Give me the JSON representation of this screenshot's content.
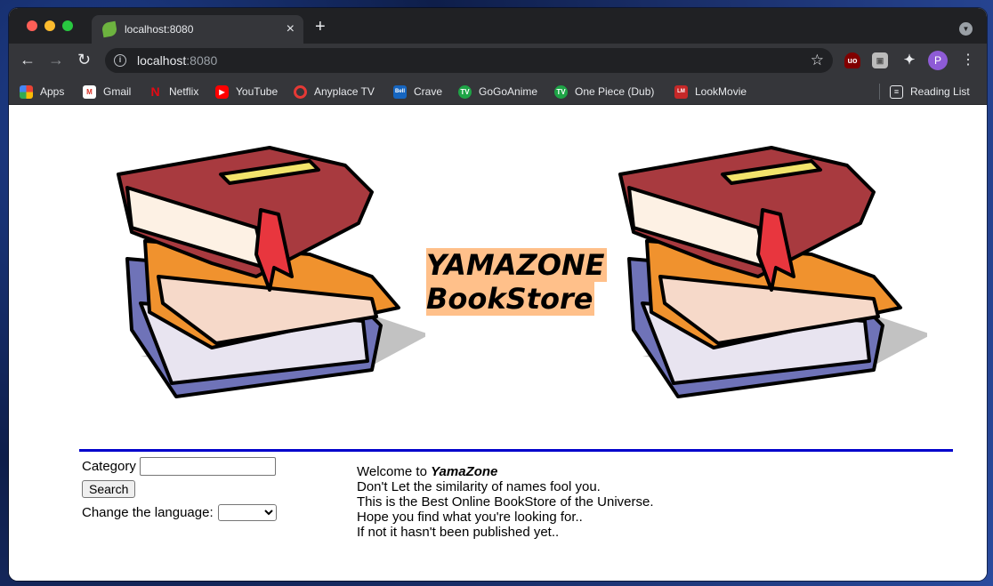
{
  "browser": {
    "tab_title": "localhost:8080",
    "new_tab_symbol": "+",
    "url_host": "localhost",
    "url_port": ":8080",
    "profile_initial": "P",
    "bookmarks": [
      {
        "label": "Apps",
        "icon": "apps-grid-icon",
        "color": "#ea4335"
      },
      {
        "label": "Gmail",
        "icon": "gmail-icon",
        "color": "#d93025"
      },
      {
        "label": "Netflix",
        "icon": "netflix-icon",
        "color": "#e50914"
      },
      {
        "label": "YouTube",
        "icon": "youtube-icon",
        "color": "#ff0000"
      },
      {
        "label": "Anyplace TV",
        "icon": "anyplace-tv-icon",
        "color": "#e53935"
      },
      {
        "label": "Crave",
        "icon": "crave-icon",
        "color": "#1565c0"
      },
      {
        "label": "GoGoAnime",
        "icon": "tv-icon",
        "color": "#1ea446"
      },
      {
        "label": "One Piece (Dub)",
        "icon": "tv-icon",
        "color": "#1ea446"
      },
      {
        "label": "LookMovie",
        "icon": "lookmovie-icon",
        "color": "#c62828"
      }
    ],
    "reading_list": "Reading List"
  },
  "page": {
    "brand_line1": "YAMAZONE",
    "brand_line2": "BookStore",
    "brand_bg_color": "#ffc08a",
    "divider_color": "#0000cc",
    "category_label": "Category",
    "category_value": "",
    "search_button": "Search",
    "language_label": "Change the language:",
    "language_selected": "",
    "welcome_prefix": "Welcome to ",
    "welcome_name": "YamaZone",
    "welcome_lines": [
      "Don't Let the similarity of names fool you.",
      "This is the Best Online BookStore of the Universe.",
      "Hope you find what you're looking for..",
      "If not it hasn't been published yet.."
    ]
  }
}
